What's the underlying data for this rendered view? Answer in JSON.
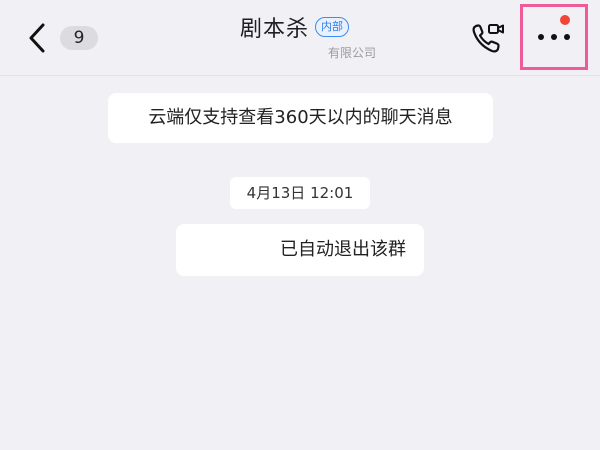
{
  "header": {
    "unread_count": "9",
    "title": "剧本杀",
    "tag": "内部",
    "subtitle": "有限公司",
    "icons": {
      "back": "chevron-left-icon",
      "call": "phone-video-icon",
      "more": "more-dots-icon"
    },
    "colors": {
      "tag_border": "#3d8bf0",
      "highlight": "#ef5a9a",
      "notification_dot": "#f0453a"
    }
  },
  "messages": {
    "notice": "云端仅支持查看360天以内的聊天消息",
    "timestamp": "4月13日 12:01",
    "system": "已自动退出该群"
  }
}
